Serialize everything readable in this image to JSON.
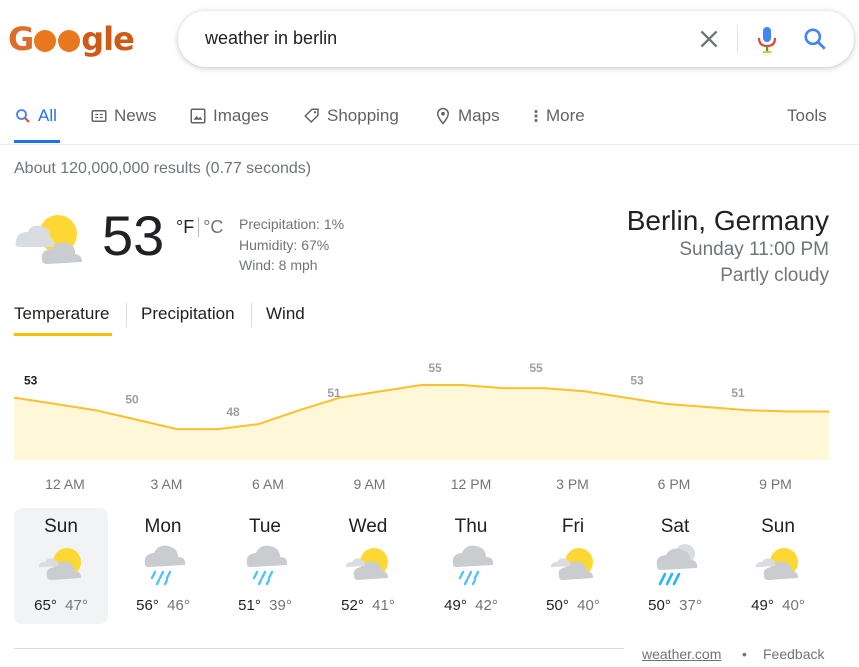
{
  "logo": {
    "letters": [
      "G",
      "",
      "",
      "gle"
    ]
  },
  "search": {
    "query": "weather in berlin"
  },
  "tabs": [
    {
      "label": "All",
      "icon": "search-icon",
      "active": true
    },
    {
      "label": "News",
      "icon": "news-icon"
    },
    {
      "label": "Images",
      "icon": "image-icon"
    },
    {
      "label": "Shopping",
      "icon": "tag-icon"
    },
    {
      "label": "Maps",
      "icon": "map-pin-icon"
    },
    {
      "label": "More",
      "icon": "more-vertical-icon"
    }
  ],
  "tools_label": "Tools",
  "stats": "About 120,000,000 results (0.77 seconds)",
  "weather": {
    "temperature": "53",
    "unit_f": "°F",
    "unit_c": "°C",
    "precipitation": "Precipitation: 1%",
    "humidity": "Humidity: 67%",
    "wind": "Wind: 8 mph",
    "location": "Berlin, Germany",
    "time": "Sunday 11:00 PM",
    "condition": "Partly cloudy",
    "icon": "partly-cloudy-icon"
  },
  "metric_tabs": [
    "Temperature",
    "Precipitation",
    "Wind"
  ],
  "chart_data": {
    "type": "area",
    "series": [
      {
        "values": [
          53,
          50,
          48,
          51,
          55,
          55,
          53,
          51
        ]
      }
    ],
    "data_labels": [
      "53",
      "50",
      "48",
      "51",
      "55",
      "55",
      "53",
      "51"
    ],
    "x": [
      "12 AM",
      "3 AM",
      "6 AM",
      "9 AM",
      "12 PM",
      "3 PM",
      "6 PM",
      "9 PM"
    ],
    "line_points": [
      53,
      52,
      51,
      49.5,
      48,
      48,
      48.8,
      51,
      53,
      54,
      55,
      55,
      54.5,
      54.5,
      54,
      53,
      52,
      51.5,
      51,
      50.8,
      50.8
    ],
    "colors": {
      "line": "#fbc02d",
      "fill": "#fef7d8"
    }
  },
  "forecast": [
    {
      "day": "Sun",
      "high": "65°",
      "low": "47°",
      "icon": "partly-cloudy-icon",
      "selected": true
    },
    {
      "day": "Mon",
      "high": "56°",
      "low": "46°",
      "icon": "rain-icon"
    },
    {
      "day": "Tue",
      "high": "51°",
      "low": "39°",
      "icon": "rain-icon"
    },
    {
      "day": "Wed",
      "high": "52°",
      "low": "41°",
      "icon": "partly-cloudy-icon"
    },
    {
      "day": "Thu",
      "high": "49°",
      "low": "42°",
      "icon": "rain-icon"
    },
    {
      "day": "Fri",
      "high": "50°",
      "low": "40°",
      "icon": "partly-cloudy-icon"
    },
    {
      "day": "Sat",
      "high": "50°",
      "low": "37°",
      "icon": "showers-icon"
    },
    {
      "day": "Sun",
      "high": "49°",
      "low": "40°",
      "icon": "partly-cloudy-icon"
    }
  ],
  "footer": {
    "source": "weather.com",
    "dot": "•",
    "feedback": "Feedback"
  }
}
